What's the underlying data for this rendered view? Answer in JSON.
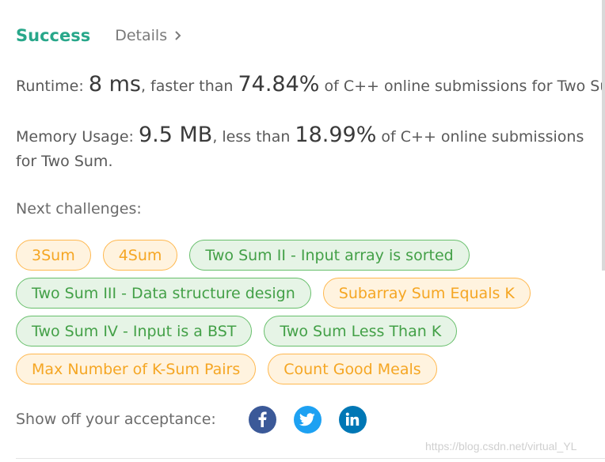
{
  "header": {
    "status": "Success",
    "details_label": "Details"
  },
  "runtime": {
    "label": "Runtime:",
    "value": "8 ms",
    "comparison": ", faster than",
    "percent": "74.84%",
    "suffix": "of C++ online submissions for Two Sum."
  },
  "memory": {
    "label": "Memory Usage:",
    "value": "9.5 MB",
    "comparison": ", less than",
    "percent": "18.99%",
    "suffix": "of C++ online submissions for Two Sum."
  },
  "next_challenges": {
    "label": "Next challenges:",
    "items": [
      {
        "label": "3Sum",
        "difficulty": "medium"
      },
      {
        "label": "4Sum",
        "difficulty": "medium"
      },
      {
        "label": "Two Sum II - Input array is sorted",
        "difficulty": "easy"
      },
      {
        "label": "Two Sum III - Data structure design",
        "difficulty": "easy"
      },
      {
        "label": "Subarray Sum Equals K",
        "difficulty": "medium"
      },
      {
        "label": "Two Sum IV - Input is a BST",
        "difficulty": "easy"
      },
      {
        "label": "Two Sum Less Than K",
        "difficulty": "easy"
      },
      {
        "label": "Max Number of K-Sum Pairs",
        "difficulty": "medium"
      },
      {
        "label": "Count Good Meals",
        "difficulty": "medium"
      }
    ]
  },
  "share": {
    "label": "Show off your acceptance:",
    "buttons": [
      {
        "icon": "facebook-icon",
        "color": "#3b5998"
      },
      {
        "icon": "twitter-icon",
        "color": "#1da1f2"
      },
      {
        "icon": "linkedin-icon",
        "color": "#0077b5"
      }
    ]
  },
  "watermark": "https://blog.csdn.net/virtual_YL",
  "colors": {
    "success": "#28a78a",
    "medium_border": "#ffb84f",
    "medium_text": "#f5a623",
    "easy_border": "#67bf6b",
    "easy_text": "#43a047"
  }
}
